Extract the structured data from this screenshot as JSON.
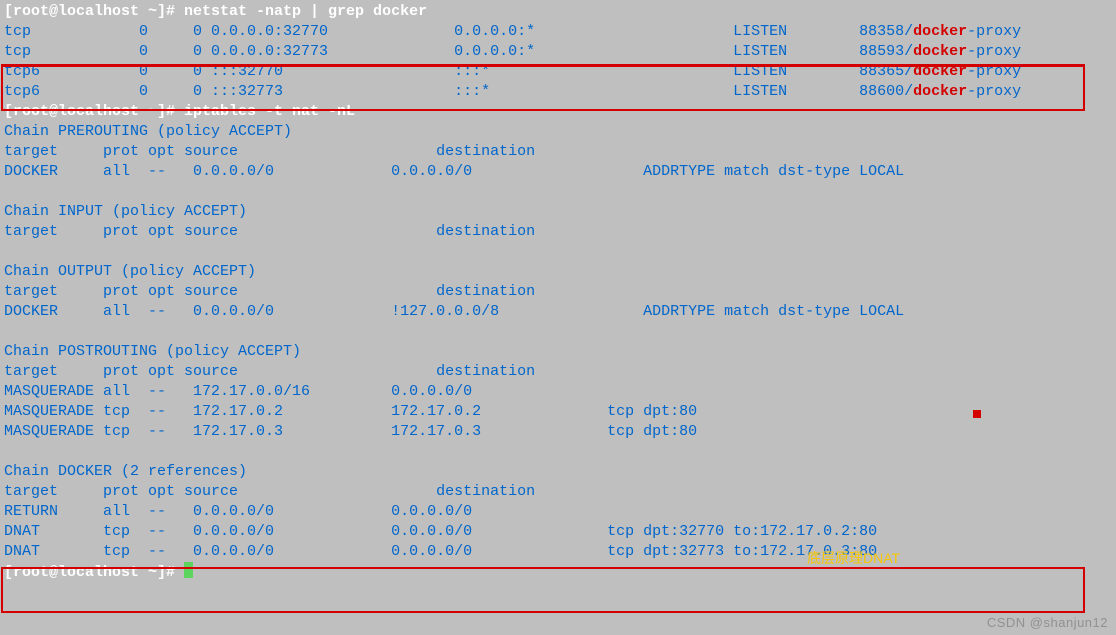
{
  "prompt_text": "[root@localhost ~]# ",
  "commands": {
    "cmd1": "netstat -natp | grep docker",
    "cmd2": "iptables -t nat -nL",
    "cmd3": ""
  },
  "netstat_rows": [
    {
      "proto": "tcp",
      "recvq": "0",
      "sendq": "0",
      "local": "0.0.0.0:32770",
      "foreign": "0.0.0.0:*",
      "state": "LISTEN",
      "pid": "88358/",
      "prog": "docker",
      "suffix": "-proxy"
    },
    {
      "proto": "tcp",
      "recvq": "0",
      "sendq": "0",
      "local": "0.0.0.0:32773",
      "foreign": "0.0.0.0:*",
      "state": "LISTEN",
      "pid": "88593/",
      "prog": "docker",
      "suffix": "-proxy"
    },
    {
      "proto": "tcp6",
      "recvq": "0",
      "sendq": "0",
      "local": ":::32770",
      "foreign": ":::*",
      "state": "LISTEN",
      "pid": "88365/",
      "prog": "docker",
      "suffix": "-proxy"
    },
    {
      "proto": "tcp6",
      "recvq": "0",
      "sendq": "0",
      "local": ":::32773",
      "foreign": ":::*",
      "state": "LISTEN",
      "pid": "88600/",
      "prog": "docker",
      "suffix": "-proxy"
    }
  ],
  "chains": {
    "prerouting_header": "Chain PREROUTING (policy ACCEPT)",
    "input_header": "Chain INPUT (policy ACCEPT)",
    "output_header": "Chain OUTPUT (policy ACCEPT)",
    "postrouting_header": "Chain POSTROUTING (policy ACCEPT)",
    "docker_header": "Chain DOCKER (2 references)"
  },
  "cols_header": {
    "target": "target",
    "prot": "prot",
    "opt": "opt",
    "source": "source",
    "destination": "destination"
  },
  "prerouting_rows": [
    {
      "target": "DOCKER",
      "prot": "all",
      "opt": "--",
      "source": "0.0.0.0/0",
      "dest": "0.0.0.0/0",
      "extra": "ADDRTYPE match dst-type LOCAL"
    }
  ],
  "output_rows": [
    {
      "target": "DOCKER",
      "prot": "all",
      "opt": "--",
      "source": "0.0.0.0/0",
      "dest": "!127.0.0.0/8",
      "extra": "ADDRTYPE match dst-type LOCAL"
    }
  ],
  "postrouting_rows": [
    {
      "target": "MASQUERADE",
      "prot": "all",
      "opt": "--",
      "source": "172.17.0.0/16",
      "dest": "0.0.0.0/0",
      "extra": ""
    },
    {
      "target": "MASQUERADE",
      "prot": "tcp",
      "opt": "--",
      "source": "172.17.0.2",
      "dest": "172.17.0.2",
      "extra": "tcp dpt:80"
    },
    {
      "target": "MASQUERADE",
      "prot": "tcp",
      "opt": "--",
      "source": "172.17.0.3",
      "dest": "172.17.0.3",
      "extra": "tcp dpt:80"
    }
  ],
  "docker_rows": [
    {
      "target": "RETURN",
      "prot": "all",
      "opt": "--",
      "source": "0.0.0.0/0",
      "dest": "0.0.0.0/0",
      "extra": ""
    },
    {
      "target": "DNAT",
      "prot": "tcp",
      "opt": "--",
      "source": "0.0.0.0/0",
      "dest": "0.0.0.0/0",
      "extra": "tcp dpt:32770 to:172.17.0.2:80"
    },
    {
      "target": "DNAT",
      "prot": "tcp",
      "opt": "--",
      "source": "0.0.0.0/0",
      "dest": "0.0.0.0/0",
      "extra": "tcp dpt:32773 to:172.17.0.3:80"
    }
  ],
  "annotation": "底层原理DNAT",
  "watermark": "CSDN @shanjun12"
}
